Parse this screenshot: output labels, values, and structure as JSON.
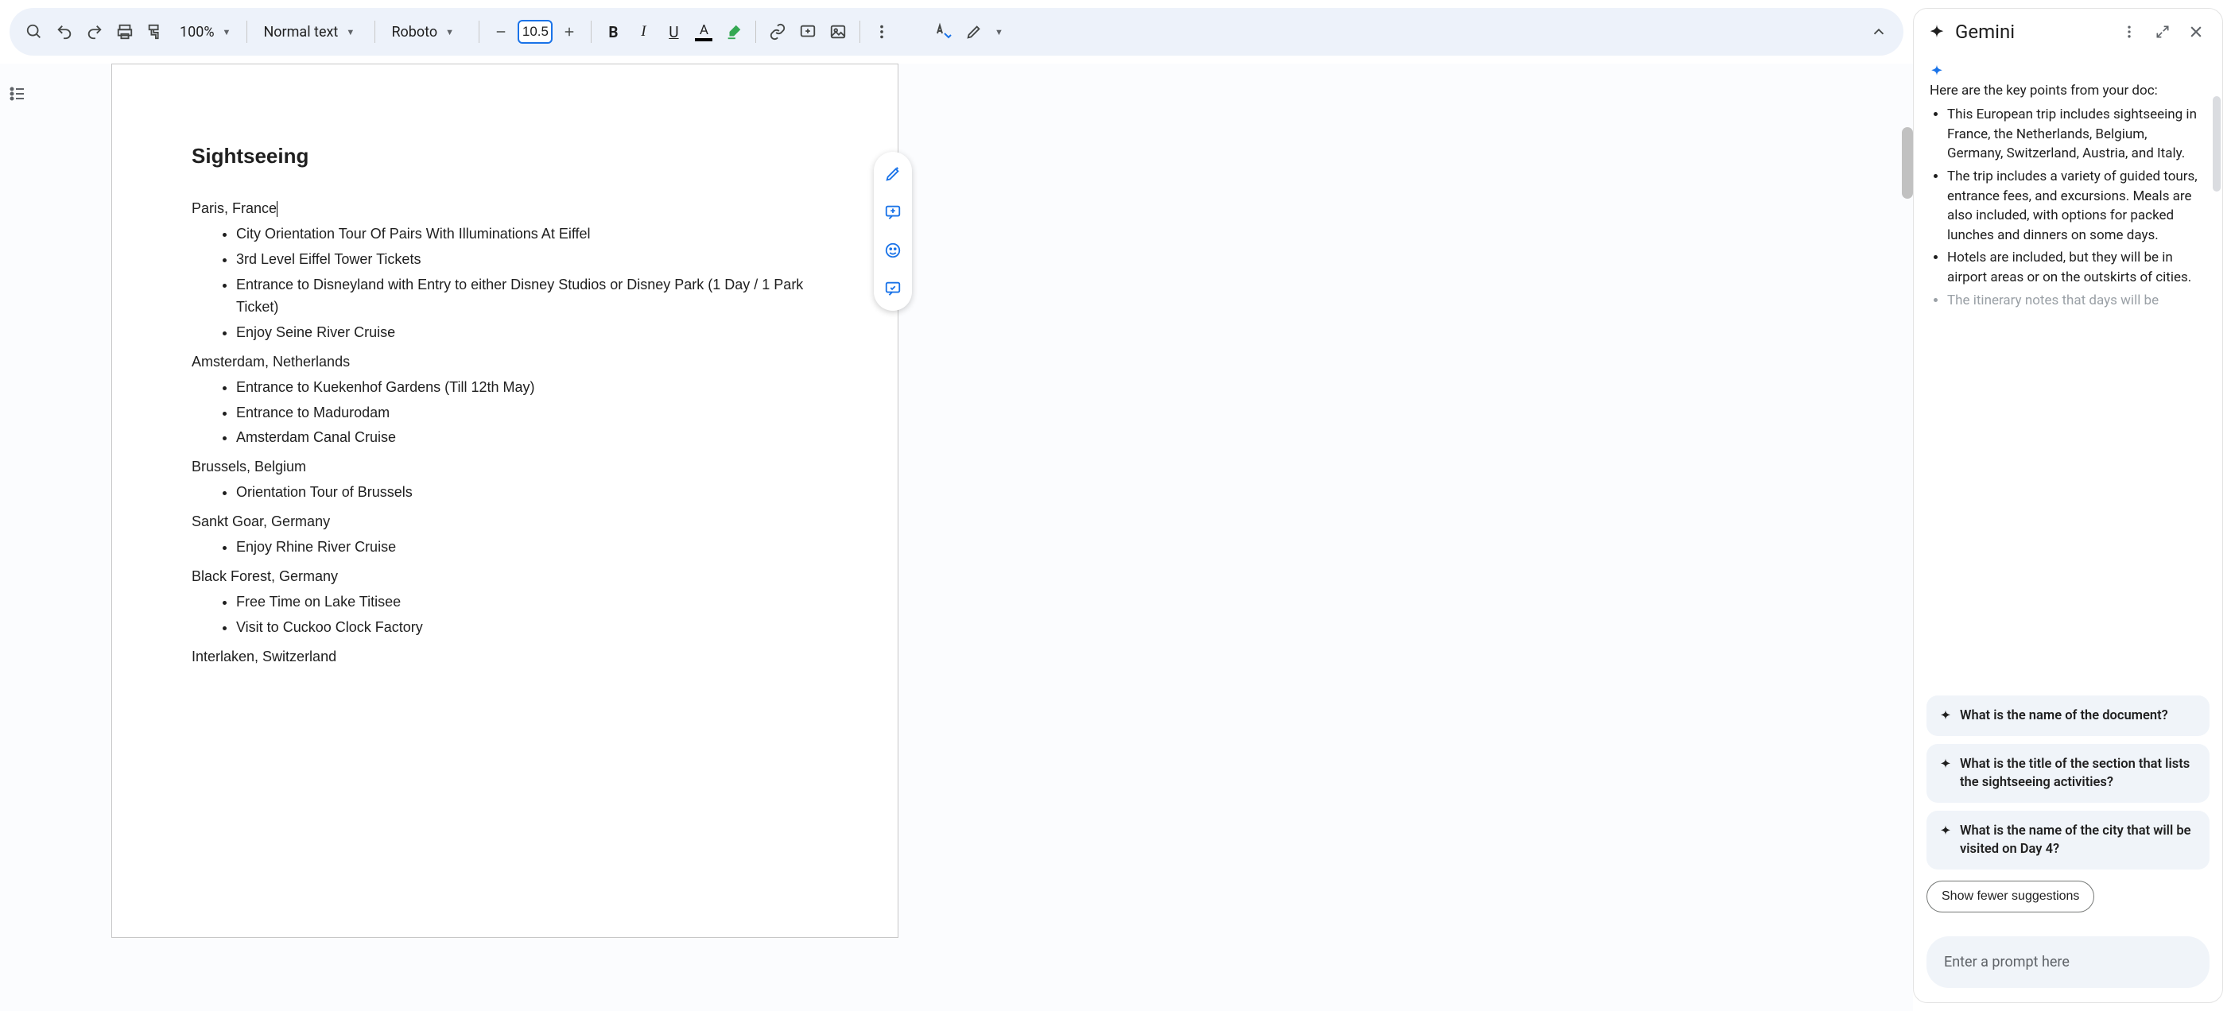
{
  "toolbar": {
    "zoom": "100%",
    "style": "Normal text",
    "font": "Roboto",
    "fontSize": "10.5"
  },
  "document": {
    "heading": "Sightseeing",
    "sections": [
      {
        "location": "Paris, France",
        "items": [
          "City Orientation Tour Of Pairs With Illuminations At Eiffel",
          "3rd Level Eiffel Tower Tickets",
          "Entrance to Disneyland with Entry to either Disney Studios or Disney Park (1 Day / 1 Park Ticket)",
          "Enjoy Seine River Cruise"
        ],
        "cursor": true
      },
      {
        "location": "Amsterdam, Netherlands",
        "items": [
          "Entrance to Kuekenhof Gardens (Till 12th May)",
          "Entrance to Madurodam",
          "Amsterdam Canal Cruise"
        ]
      },
      {
        "location": "Brussels, Belgium",
        "items": [
          "Orientation Tour of Brussels"
        ]
      },
      {
        "location": "Sankt Goar, Germany",
        "items": [
          "Enjoy Rhine River Cruise"
        ]
      },
      {
        "location": "Black Forest, Germany",
        "items": [
          "Free Time on Lake Titisee",
          "Visit to Cuckoo Clock Factory"
        ]
      },
      {
        "location": "Interlaken, Switzerland",
        "items": []
      }
    ]
  },
  "sidePanel": {
    "title": "Gemini",
    "intro": "Here are the key points from your doc:",
    "bullets": [
      {
        "text": "This European trip includes sightseeing in France, the Netherlands, Belgium, Germany, Switzerland, Austria, and Italy.",
        "fade": false
      },
      {
        "text": "The trip includes a variety of guided tours, entrance fees, and excursions. Meals are also included, with options for packed lunches and dinners on some days.",
        "fade": false
      },
      {
        "text": "Hotels are included, but they will be in airport areas or on the outskirts of cities.",
        "fade": false
      },
      {
        "text": "The itinerary notes that days will be",
        "fade": true
      }
    ],
    "suggestions": [
      "What is the name of the document?",
      "What is the title of the section that lists the sightseeing activities?",
      "What is the name of the city that will be visited on Day 4?"
    ],
    "showFewer": "Show fewer suggestions",
    "promptPlaceholder": "Enter a prompt here"
  }
}
